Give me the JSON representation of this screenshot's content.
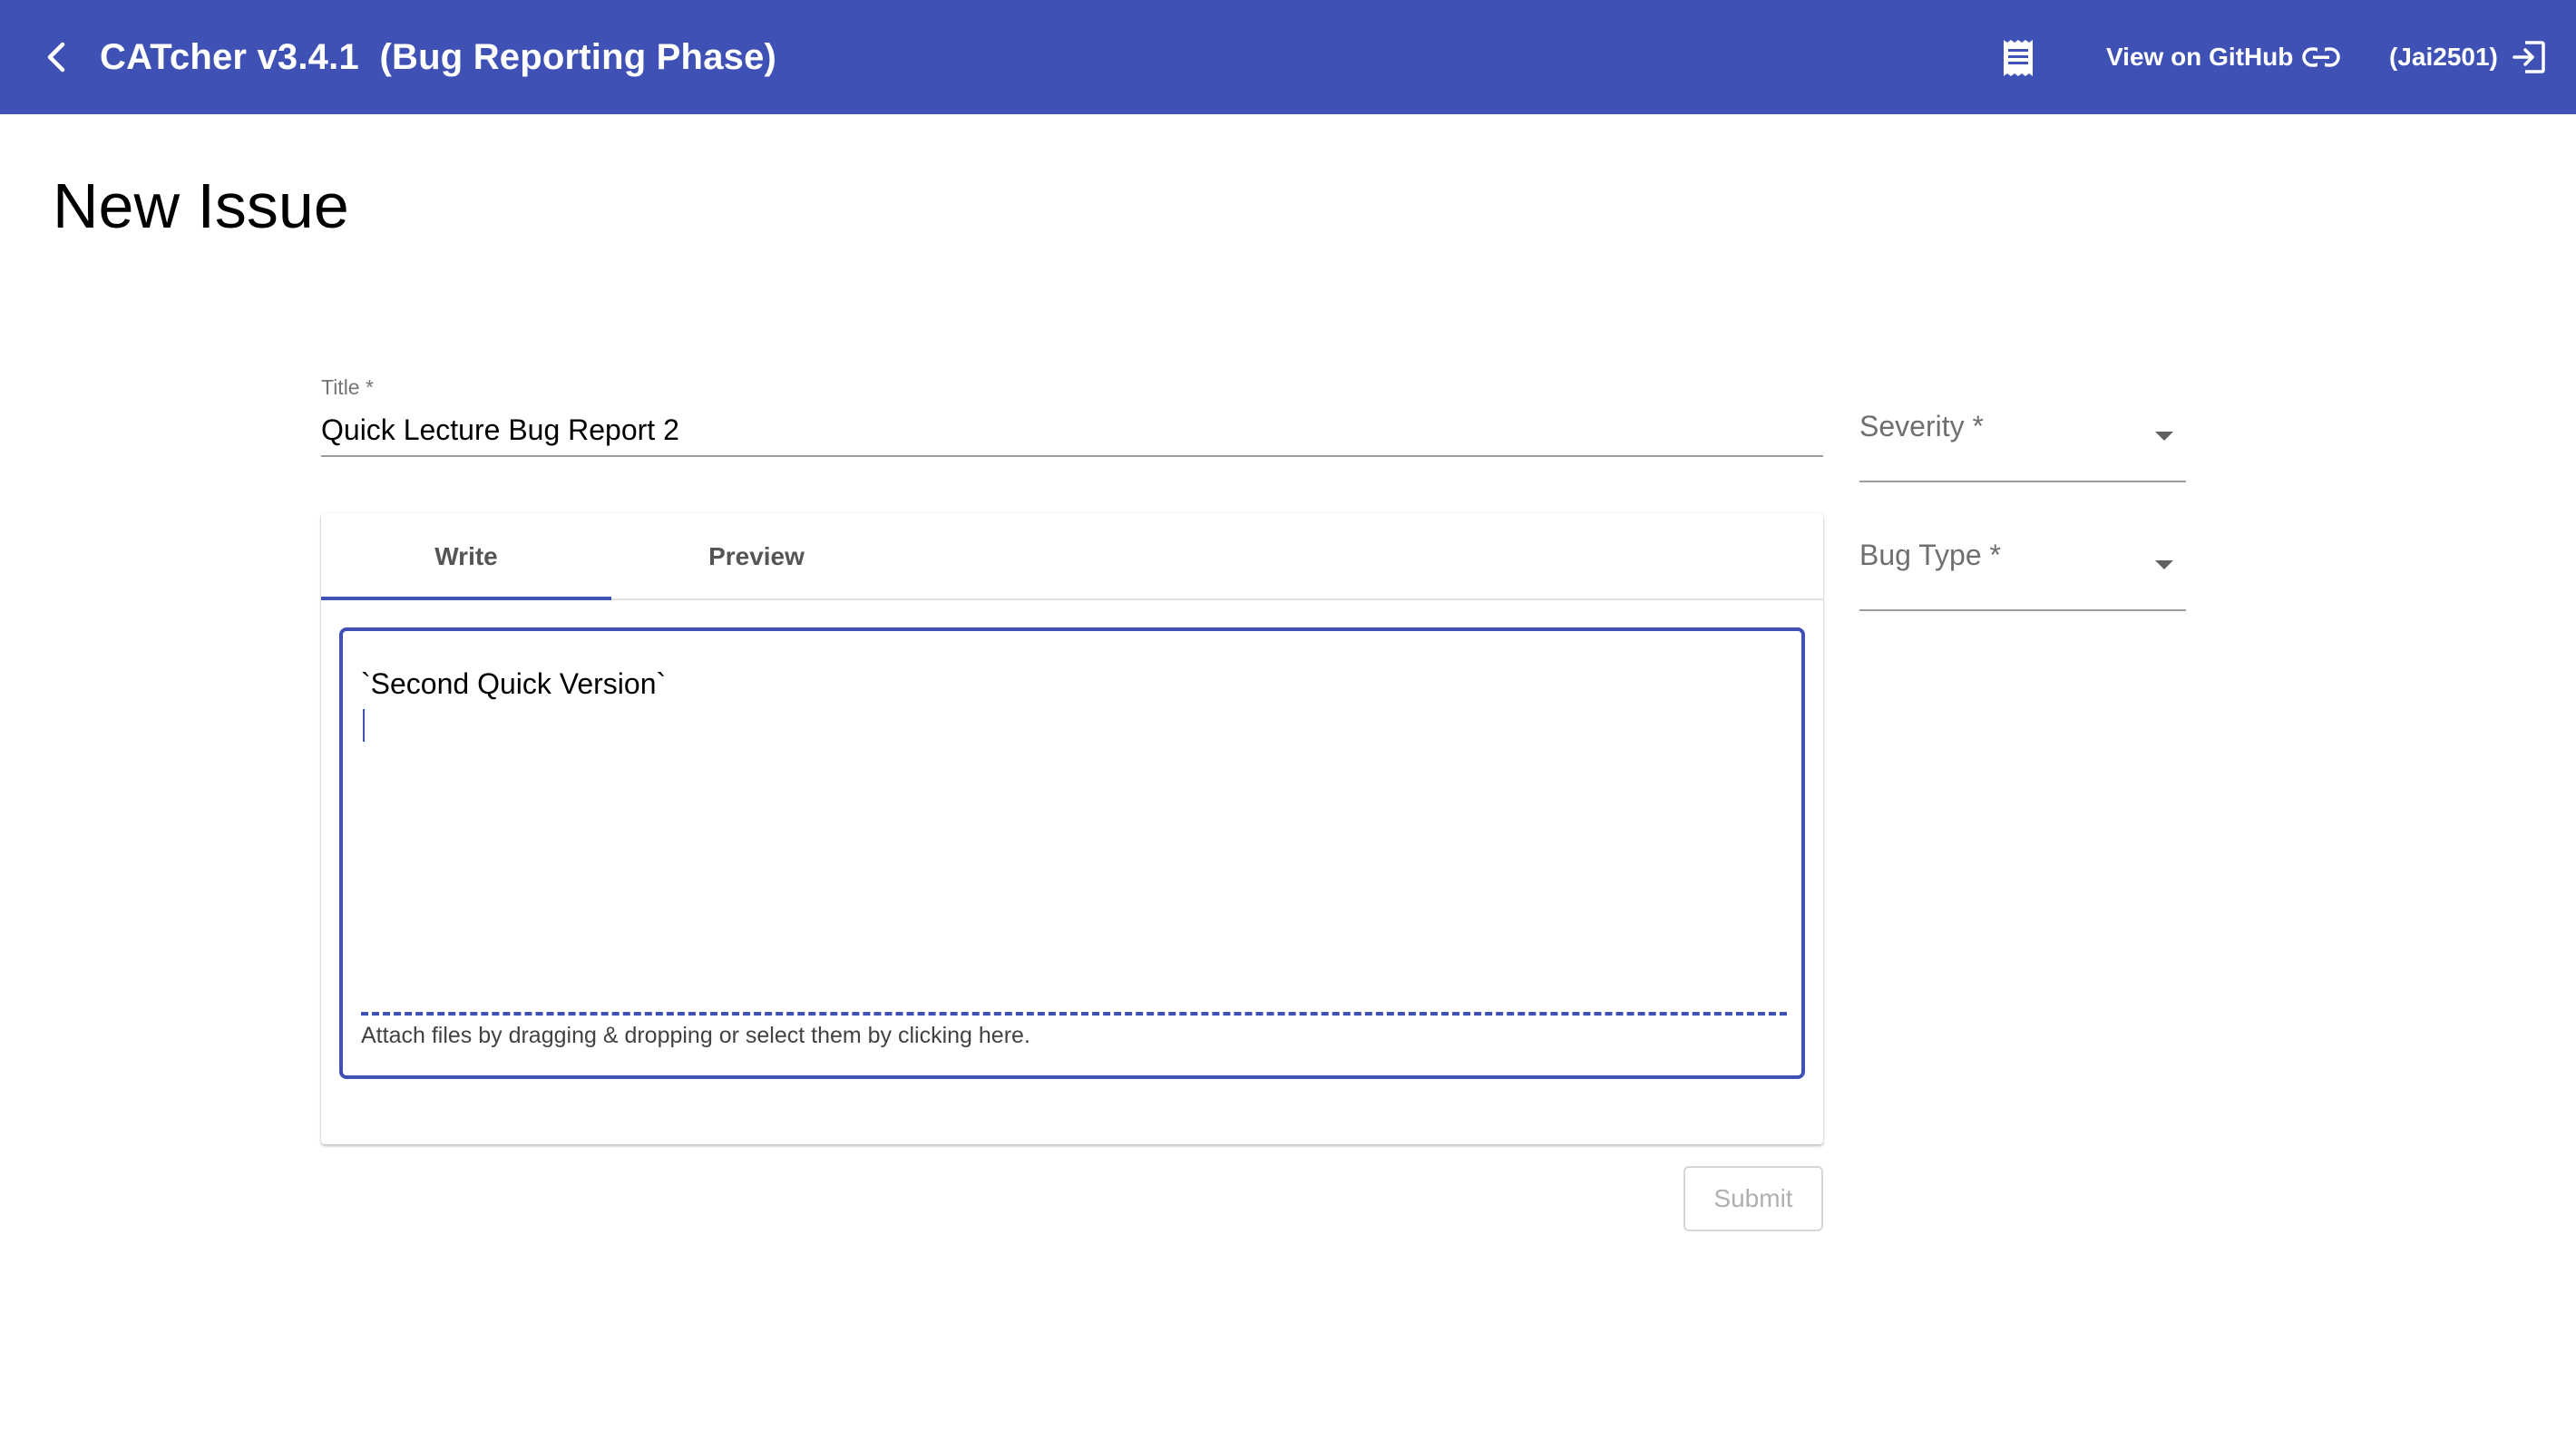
{
  "colors": {
    "primary": "#3f51b5",
    "on_primary": "#ffffff"
  },
  "toolbar": {
    "app_title": "CATcher v3.4.1  (Bug Reporting Phase)",
    "back_icon": "chevron-left-icon",
    "notes_icon": "receipt-icon",
    "github_label": "View on GitHub",
    "github_icon": "link-icon",
    "user_label": "(Jai2501)",
    "logout_icon": "logout-icon"
  },
  "page": {
    "title": "New Issue"
  },
  "form": {
    "title_label": "Title *",
    "title_value": "Quick Lecture Bug Report 2",
    "severity_label": "Severity *",
    "bug_type_label": "Bug Type *",
    "tabs": [
      {
        "label": "Write",
        "active": true
      },
      {
        "label": "Preview",
        "active": false
      }
    ],
    "description_value": "`Second Quick Version`",
    "attach_hint": "Attach files by dragging & dropping or select them by clicking here.",
    "submit_label": "Submit",
    "submit_disabled": true
  }
}
